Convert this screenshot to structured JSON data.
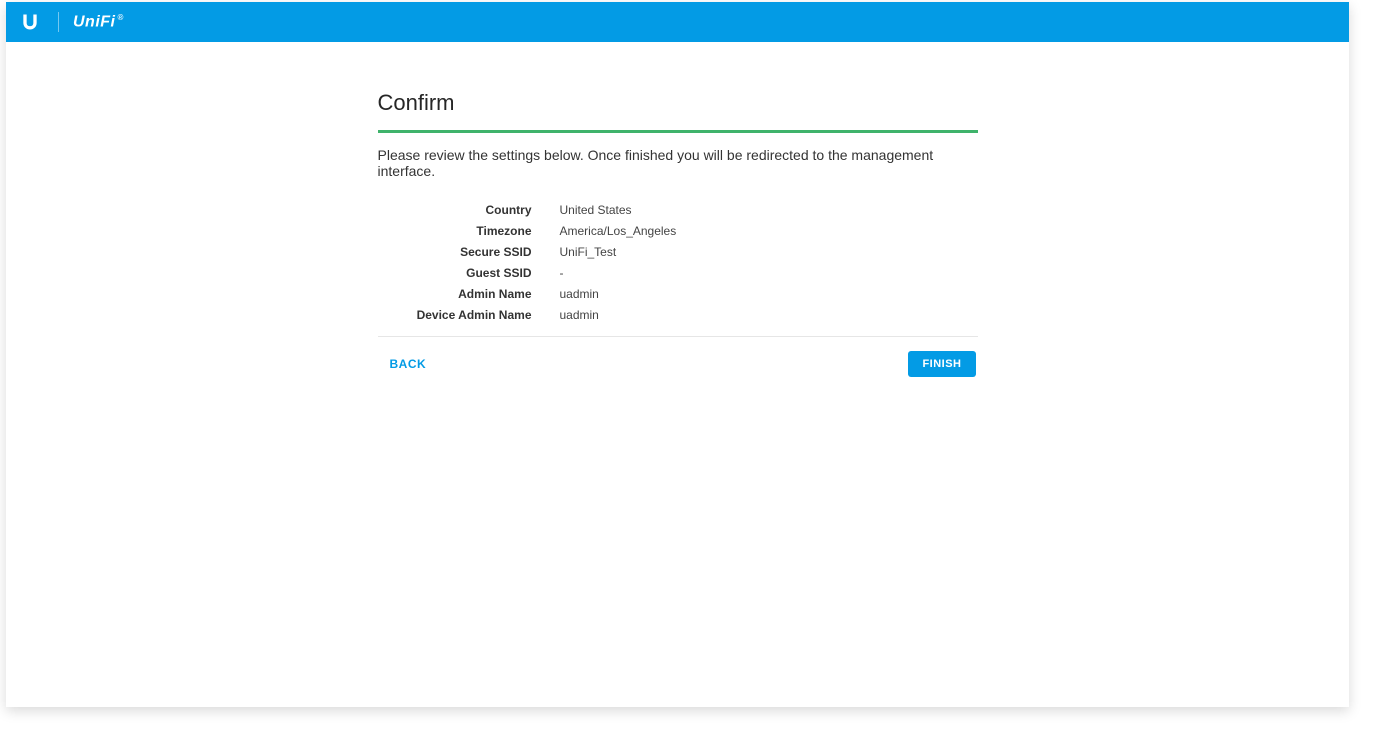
{
  "brand": {
    "mark": "U",
    "wordmark": "UniFi",
    "trademark": "®"
  },
  "page": {
    "title": "Confirm",
    "description": "Please review the settings below. Once finished you will be redirected to the management interface."
  },
  "settings": {
    "items": [
      {
        "label": "Country",
        "value": "United States"
      },
      {
        "label": "Timezone",
        "value": "America/Los_Angeles"
      },
      {
        "label": "Secure SSID",
        "value": "UniFi_Test"
      },
      {
        "label": "Guest SSID",
        "value": "-"
      },
      {
        "label": "Admin Name",
        "value": "uadmin"
      },
      {
        "label": "Device Admin Name",
        "value": "uadmin"
      }
    ]
  },
  "footer": {
    "back_label": "BACK",
    "finish_label": "FINISH"
  },
  "colors": {
    "brand_primary": "#039be5",
    "progress_green": "#3fb36b"
  }
}
